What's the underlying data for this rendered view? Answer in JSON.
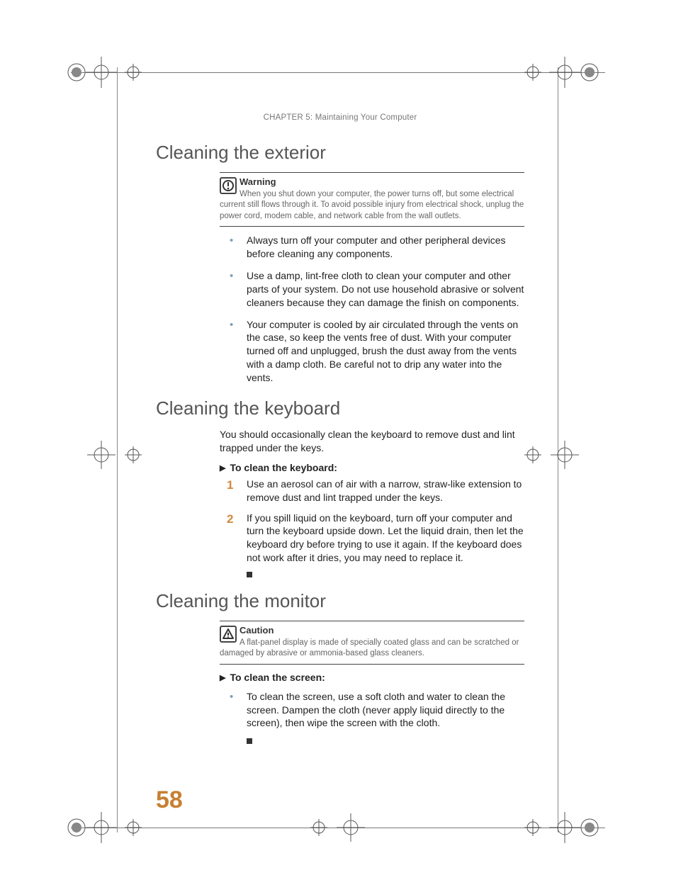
{
  "header": {
    "chapter_label": "CHAPTER 5",
    "chapter_title": "Maintaining Your Computer"
  },
  "sections": {
    "exterior": {
      "title": "Cleaning the exterior",
      "warning": {
        "title": "Warning",
        "body": "When you shut down your computer, the power turns off, but some electrical current still flows through it. To avoid possible injury from electrical shock, unplug the power cord, modem cable, and network cable from the wall outlets."
      },
      "bullets": [
        "Always turn off your computer and other peripheral devices before cleaning any components.",
        "Use a damp, lint-free cloth to clean your computer and other parts of your system. Do not use household abrasive or solvent cleaners because they can damage the finish on components.",
        "Your computer is cooled by air circulated through the vents on the case, so keep the vents free of dust. With your computer turned off and unplugged, brush the dust away from the vents with a damp cloth. Be careful not to drip any water into the vents."
      ]
    },
    "keyboard": {
      "title": "Cleaning the keyboard",
      "intro": "You should occasionally clean the keyboard to remove dust and lint trapped under the keys.",
      "proc_title": "To clean the keyboard:",
      "steps": [
        "Use an aerosol can of air with a narrow, straw-like extension to remove dust and lint trapped under the keys.",
        "If you spill liquid on the keyboard, turn off your computer and turn the keyboard upside down. Let the liquid drain, then let the keyboard dry before trying to use it again. If the keyboard does not work after it dries, you may need to replace it."
      ]
    },
    "monitor": {
      "title": "Cleaning the monitor",
      "caution": {
        "title": "Caution",
        "body": "A flat-panel display is made of specially coated glass and can be scratched or damaged by abrasive or ammonia-based glass cleaners."
      },
      "proc_title": "To clean the screen:",
      "bullets": [
        "To clean the screen, use a soft cloth and water to clean the screen. Dampen the cloth (never apply liquid directly to the screen), then wipe the screen with the cloth."
      ]
    }
  },
  "page_number": "58"
}
